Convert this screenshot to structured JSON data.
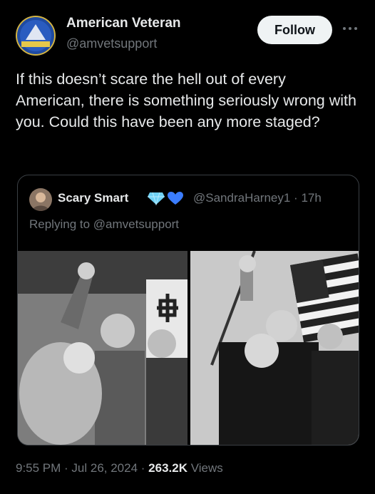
{
  "author": {
    "name": "American Veteran",
    "handle": "@amvetsupport",
    "avatar_icon": "veteran-emblem-icon"
  },
  "follow_label": "Follow",
  "more_icon": "more-options-icon",
  "tweet_text": "If this doesn’t scare the hell out of every American, there is something seriously wrong with you. Could this have been any more staged?",
  "quote": {
    "name": "Scary Smart",
    "badges": [
      "diamond-icon",
      "blue-heart-icon"
    ],
    "handle_time": "@SandraHarney1 · 17h",
    "reply_to": "Replying to @amvetsupport",
    "images": [
      {
        "name": "black-and-white-rally-photo",
        "description_icon": "photo"
      },
      {
        "name": "black-and-white-flag-photo",
        "description_icon": "photo"
      }
    ]
  },
  "meta": {
    "time_date": "9:55 PM · Jul 26, 2024 · ",
    "views_count": "263.2K",
    "views_label": " Views"
  },
  "colors": {
    "background": "#000000",
    "text": "#e7e9ea",
    "muted": "#71767b",
    "border": "#3a3f44",
    "follow_bg": "#eff3f4"
  }
}
